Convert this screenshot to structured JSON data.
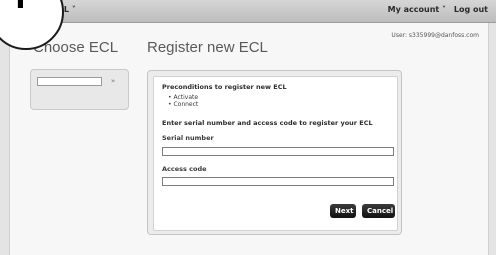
{
  "topbar": {
    "menu_left": "CL ˅",
    "my_account": "My account ˅",
    "logout": "Log out"
  },
  "user_info": "User: s335999@danfoss.com",
  "headings": {
    "choose": "Choose ECL",
    "register": "Register new ECL"
  },
  "left_panel": {
    "search_value": "",
    "go_label": "»"
  },
  "register": {
    "preconditions_title": "Preconditions to register new ECL",
    "bullets": [
      "Activate",
      "Connect"
    ],
    "instruction": "Enter serial number and access code to register your ECL",
    "serial_label": "Serial number",
    "serial_value": "",
    "access_label": "Access code",
    "access_value": "",
    "next_label": "Next",
    "cancel_label": "Cancel"
  },
  "corner_icon": "plus-icon"
}
